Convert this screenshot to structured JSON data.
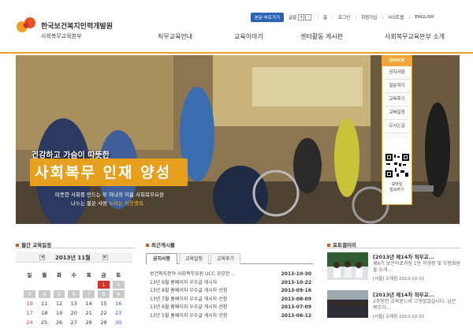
{
  "header": {
    "org_name": "한국보건복지인력개발원",
    "org_sub": "사회복무교육본부",
    "shortcut": "본문 바로가기",
    "font_size_label": "글꼴",
    "font_plus": "+",
    "font_minus": "-",
    "util_links": [
      "홈",
      "로그인",
      "회원가입",
      "사이트맵",
      "ENGLISH"
    ]
  },
  "gnb": [
    "직무교육안내",
    "교육이야기",
    "센터활동 게시판",
    "사회복무교육본부 소개"
  ],
  "hero": {
    "tag_small": "건강하고 가슴이 따뜻한",
    "tag_big": "사회복무 인재 양성",
    "line1": "따뜻한 사회를 만드는 또 하나의 이름 사회복무요원",
    "line2_prefix": "나누는 젊은 사랑 ",
    "line2_accent": "누리는 이웃행복"
  },
  "quick_menu": {
    "title": "QUICK MENU",
    "items": [
      "공지사항",
      "질문하기",
      "교육후기",
      "교육일정",
      "오시는길"
    ],
    "mobile_line1": "모바일",
    "mobile_line2": "접속하기"
  },
  "calendar": {
    "title": "월간 교육일정",
    "month_label": "2013년 11월",
    "weekdays": [
      "일",
      "월",
      "화",
      "수",
      "목",
      "금",
      "토"
    ],
    "weeks": [
      [
        "",
        "",
        "",
        "",
        "",
        "1",
        "2"
      ],
      [
        "3",
        "4",
        "5",
        "6",
        "7",
        "8",
        "9"
      ],
      [
        "10",
        "11",
        "12",
        "13",
        "14",
        "15",
        "16"
      ],
      [
        "17",
        "18",
        "19",
        "20",
        "21",
        "22",
        "23"
      ],
      [
        "24",
        "25",
        "26",
        "27",
        "28",
        "29",
        "30"
      ]
    ]
  },
  "news": {
    "title": "최근게시물",
    "tabs": [
      "공지사항",
      "교육일정",
      "교육후기"
    ],
    "rows": [
      {
        "title": "보건복지분야 사회복무요원 UCC 공모전 ...",
        "date": "2013-10-30"
      },
      {
        "title": "13년 9월 홈페이지 우수글 게시자",
        "date": "2013-10-22"
      },
      {
        "title": "13년 8월 홈페이지 우수글 게시자 선정",
        "date": "2013-09-16"
      },
      {
        "title": "13년 7월 홈페이지 우수글 게시자 선정",
        "date": "2013-08-09"
      },
      {
        "title": "13년 6월 홈페이지 우수글 게시자 선정",
        "date": "2013-07-09"
      },
      {
        "title": "13년 5월 홈페이지 우수글 게시자 선정",
        "date": "2013-06-12"
      }
    ]
  },
  "gallery": {
    "title": "포토갤러리",
    "items": [
      {
        "title": "[2013년 제14차 직무교...",
        "desc": "제6기 보건의료과정 1반 학생장 및 모범회원들 소개...",
        "meta": "[서울] 오재환  2013-10-31"
      },
      {
        "title": "[2013년 제14차 직무교...",
        "desc": "2주동안 교육받느라 고생많았습니다. 남은 복무기...",
        "meta": "[서울] 오재환  2013-10-31"
      }
    ]
  },
  "colors": {
    "accent_orange": "#e8a22b",
    "brand_red": "#d3302f",
    "link_blue": "#2b62b5"
  }
}
